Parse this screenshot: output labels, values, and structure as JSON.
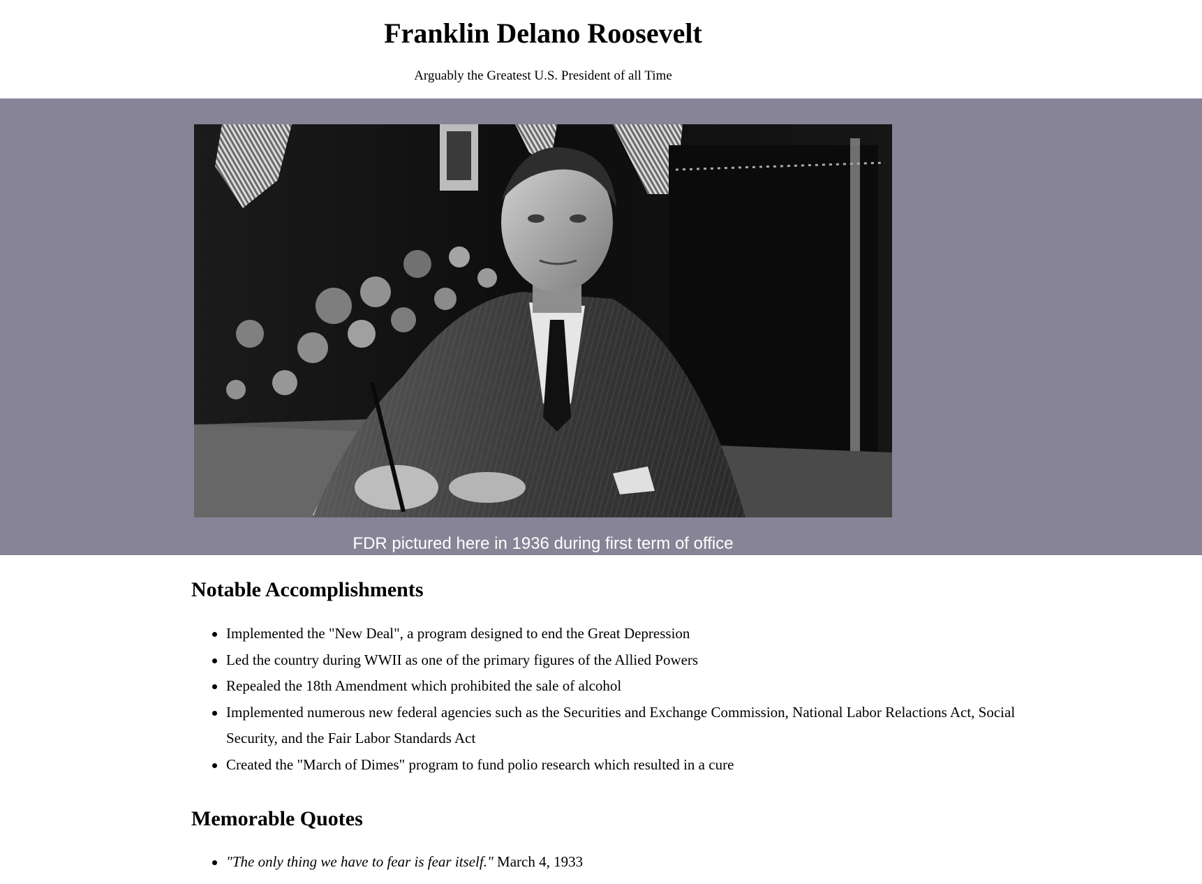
{
  "header": {
    "title": "Franklin Delano Roosevelt",
    "subtitle": "Arguably the Greatest U.S. President of all Time"
  },
  "hero": {
    "image_alt": "Black and white photograph of FDR seated at a desk signing a document, with a bouquet of flowers and flags behind him",
    "caption": "FDR pictured here in 1936 during first term of office",
    "band_color": "#878497"
  },
  "accomplishments": {
    "heading": "Notable Accomplishments",
    "items": [
      "Implemented the \"New Deal\", a program designed to end the Great Depression",
      "Led the country during WWII as one of the primary figures of the Allied Powers",
      "Repealed the 18th Amendment which prohibited the sale of alcohol",
      "Implemented numerous new federal agencies such as the Securities and Exchange Commission, National Labor Relactions Act, Social Security, and the Fair Labor Standards Act",
      "Created the \"March of Dimes\" program to fund polio research which resulted in a cure"
    ]
  },
  "quotes": {
    "heading": "Memorable Quotes",
    "items": [
      {
        "quote": "\"The only thing we have to fear is fear itself.\"",
        "date": " March 4, 1933"
      }
    ]
  }
}
